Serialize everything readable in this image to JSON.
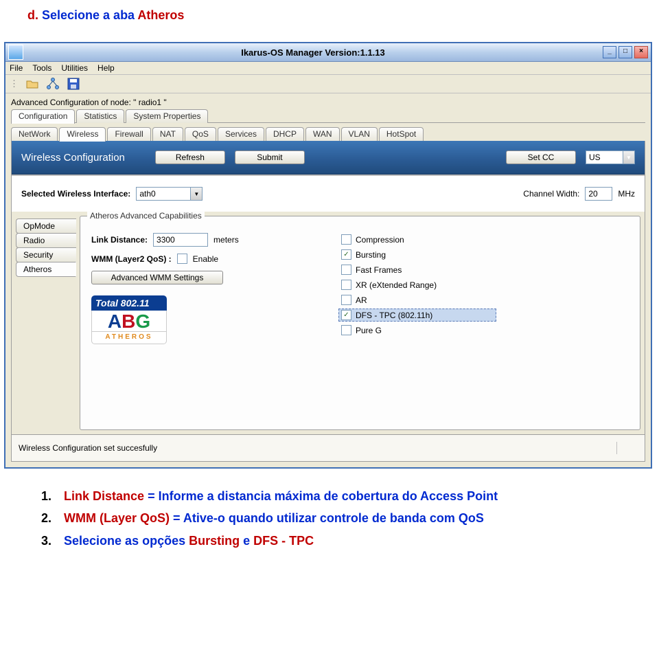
{
  "doc": {
    "heading_prefix": "d. ",
    "heading_text": "Selecione a aba ",
    "heading_em": "Atheros",
    "list": [
      {
        "n": "1.",
        "label": "Link Distance",
        "desc": " = Informe a distancia máxima de cobertura do Access Point"
      },
      {
        "n": "2.",
        "label": "WMM (Layer QoS)",
        "desc": " = Ative-o quando utilizar controle de banda com QoS"
      },
      {
        "n": "3.",
        "label": "",
        "desc_pre": "Selecione as opções ",
        "em1": "Bursting",
        "mid": " e ",
        "em2": "DFS - TPC"
      }
    ]
  },
  "titlebar": {
    "title": "Ikarus-OS Manager   Version:1.1.13"
  },
  "menubar": [
    "File",
    "Tools",
    "Utilities",
    "Help"
  ],
  "nodeRow": "Advanced Configuration of node:   \" radio1 \"",
  "topTabs": [
    "Configuration",
    "Statistics",
    "System Properties"
  ],
  "topTabsActive": 0,
  "subTabs": [
    "NetWork",
    "Wireless",
    "Firewall",
    "NAT",
    "QoS",
    "Services",
    "DHCP",
    "WAN",
    "VLAN",
    "HotSpot"
  ],
  "subTabsActive": 1,
  "panelHeader": {
    "title": "Wireless Configuration",
    "refresh": "Refresh",
    "submit": "Submit",
    "setcc": "Set CC",
    "cc_value": "US"
  },
  "midRow": {
    "label_iface": "Selected Wireless Interface:",
    "iface_value": "ath0",
    "label_cw": "Channel Width:",
    "cw_value": "20",
    "cw_unit": "MHz"
  },
  "sideTabs": [
    "OpMode",
    "Radio",
    "Security",
    "Atheros"
  ],
  "sideTabsActive": 3,
  "fieldset": {
    "legend": "Atheros Advanced Capabilities",
    "link_distance_label": "Link Distance:",
    "link_distance_value": "3300",
    "link_distance_unit": "meters",
    "wmm_label": "WMM (Layer2 QoS) :",
    "wmm_enable": "Enable",
    "wmm_btn": "Advanced WMM Settings",
    "checks": [
      {
        "label": "Compression",
        "checked": false,
        "selected": false
      },
      {
        "label": "Bursting",
        "checked": true,
        "selected": false
      },
      {
        "label": "Fast Frames",
        "checked": false,
        "selected": false
      },
      {
        "label": "XR (eXtended Range)",
        "checked": false,
        "selected": false
      },
      {
        "label": "AR",
        "checked": false,
        "selected": false
      },
      {
        "label": "DFS - TPC (802.11h)",
        "checked": true,
        "selected": true
      },
      {
        "label": "Pure G",
        "checked": false,
        "selected": false
      }
    ],
    "logo_total": "Total 802.11",
    "logo_abg_colors": {
      "A": "#0b3d91",
      "B": "#c01020",
      "G": "#1a9a4a"
    },
    "logo_atheros": "ATHEROS"
  },
  "statusbar": "Wireless Configuration set succesfully"
}
